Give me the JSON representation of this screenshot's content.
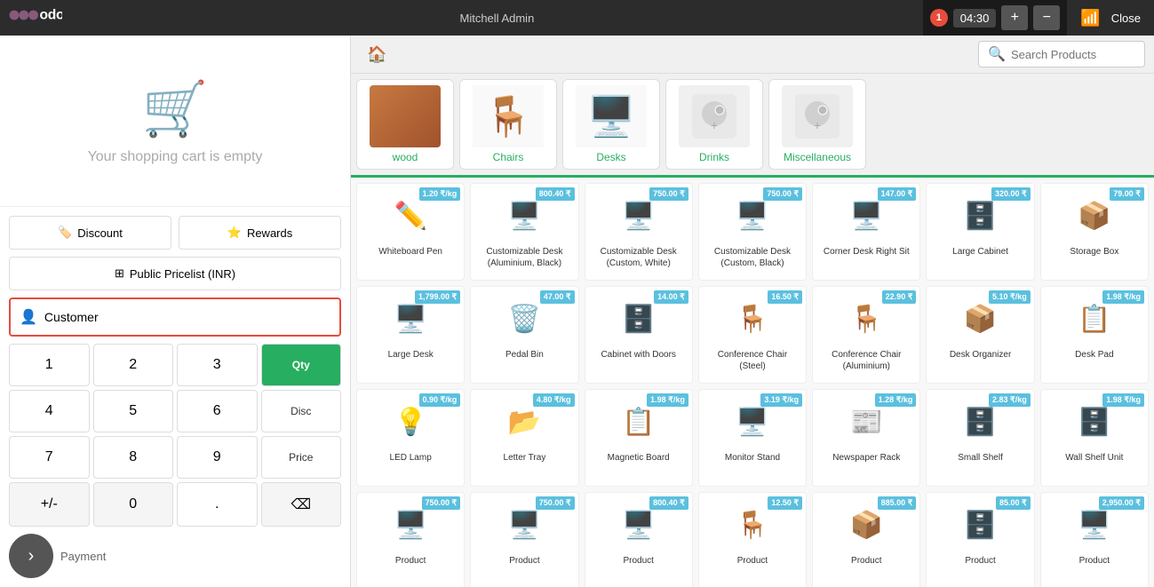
{
  "topbar": {
    "logo": "odoo",
    "user": "Mitchell Admin",
    "order_number": "1",
    "order_time": "04:30",
    "add_label": "+",
    "minus_label": "−",
    "close_label": "Close"
  },
  "cart": {
    "empty_text": "Your shopping cart is empty"
  },
  "controls": {
    "discount_label": "Discount",
    "rewards_label": "Rewards",
    "pricelist_label": "Public Pricelist (INR)",
    "customer_label": "Customer"
  },
  "numpad": {
    "keys": [
      "1",
      "2",
      "3",
      "4",
      "5",
      "6",
      "7",
      "8",
      "9",
      "+/-",
      "0",
      "."
    ],
    "qty_label": "Qty",
    "disc_label": "Disc",
    "price_label": "Price",
    "payment_label": "Payment"
  },
  "search": {
    "placeholder": "Search Products"
  },
  "categories": [
    {
      "label": "wood",
      "emoji": "🟫"
    },
    {
      "label": "Chairs",
      "emoji": "🪑"
    },
    {
      "label": "Desks",
      "emoji": "🪑"
    },
    {
      "label": "Drinks",
      "emoji": "📷"
    },
    {
      "label": "Miscellaneous",
      "emoji": "📷"
    }
  ],
  "products": [
    {
      "name": "Whiteboard Pen",
      "price": "1.20 ₹/kg",
      "emoji": "✏️",
      "badge_color": "#5bc0de"
    },
    {
      "name": "Customizable Desk (Aluminium, Black)",
      "price": "800.40 ₹",
      "emoji": "🖥️",
      "badge_color": "#5bc0de"
    },
    {
      "name": "Customizable Desk (Custom, White)",
      "price": "750.00 ₹",
      "emoji": "🖥️",
      "badge_color": "#5bc0de"
    },
    {
      "name": "Customizable Desk (Custom, Black)",
      "price": "750.00 ₹",
      "emoji": "🖥️",
      "badge_color": "#5bc0de"
    },
    {
      "name": "Corner Desk Right Sit",
      "price": "147.00 ₹",
      "emoji": "🖥️",
      "badge_color": "#5bc0de"
    },
    {
      "name": "Large Cabinet",
      "price": "320.00 ₹",
      "emoji": "🗄️",
      "badge_color": "#5bc0de"
    },
    {
      "name": "Storage Box",
      "price": "79.00 ₹",
      "emoji": "📦",
      "badge_color": "#5bc0de"
    },
    {
      "name": "Large Desk",
      "price": "1,799.00 ₹",
      "emoji": "🖥️",
      "badge_color": "#5bc0de"
    },
    {
      "name": "Pedal Bin",
      "price": "47.00 ₹",
      "emoji": "🗑️",
      "badge_color": "#5bc0de"
    },
    {
      "name": "Cabinet with Doors",
      "price": "14.00 ₹",
      "emoji": "🗄️",
      "badge_color": "#5bc0de"
    },
    {
      "name": "Conference Chair (Steel)",
      "price": "16.50 ₹",
      "emoji": "🪑",
      "badge_color": "#5bc0de"
    },
    {
      "name": "Conference Chair (Aluminium)",
      "price": "22.90 ₹",
      "emoji": "🪑",
      "badge_color": "#5bc0de"
    },
    {
      "name": "Desk Organizer",
      "price": "5.10 ₹/kg",
      "emoji": "📦",
      "badge_color": "#5bc0de"
    },
    {
      "name": "Desk Pad",
      "price": "1.98 ₹/kg",
      "emoji": "📋",
      "badge_color": "#5bc0de"
    },
    {
      "name": "LED Lamp",
      "price": "0.90 ₹/kg",
      "emoji": "💡",
      "badge_color": "#5bc0de"
    },
    {
      "name": "Letter Tray",
      "price": "4.80 ₹/kg",
      "emoji": "📂",
      "badge_color": "#5bc0de"
    },
    {
      "name": "Magnetic Board",
      "price": "1.98 ₹/kg",
      "emoji": "📋",
      "badge_color": "#5bc0de"
    },
    {
      "name": "Monitor Stand",
      "price": "3.19 ₹/kg",
      "emoji": "🖥️",
      "badge_color": "#5bc0de"
    },
    {
      "name": "Newspaper Rack",
      "price": "1.28 ₹/kg",
      "emoji": "📰",
      "badge_color": "#5bc0de"
    },
    {
      "name": "Small Shelf",
      "price": "2.83 ₹/kg",
      "emoji": "🗄️",
      "badge_color": "#5bc0de"
    },
    {
      "name": "Wall Shelf Unit",
      "price": "1.98 ₹/kg",
      "emoji": "🗄️",
      "badge_color": "#5bc0de"
    },
    {
      "name": "Product",
      "price": "750.00 ₹",
      "emoji": "🖥️",
      "badge_color": "#5bc0de"
    },
    {
      "name": "Product",
      "price": "750.00 ₹",
      "emoji": "🖥️",
      "badge_color": "#5bc0de"
    },
    {
      "name": "Product",
      "price": "800.40 ₹",
      "emoji": "🖥️",
      "badge_color": "#5bc0de"
    },
    {
      "name": "Product",
      "price": "12.50 ₹",
      "emoji": "🪑",
      "badge_color": "#5bc0de"
    },
    {
      "name": "Product",
      "price": "885.00 ₹",
      "emoji": "📦",
      "badge_color": "#5bc0de"
    },
    {
      "name": "Product",
      "price": "85.00 ₹",
      "emoji": "🗄️",
      "badge_color": "#5bc0de"
    },
    {
      "name": "Product",
      "price": "2,950.00 ₹",
      "emoji": "🖥️",
      "badge_color": "#5bc0de"
    }
  ]
}
